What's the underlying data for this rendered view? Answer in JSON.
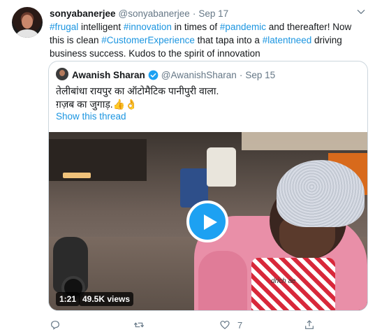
{
  "tweet": {
    "author_name": "sonyabanerjee",
    "author_handle": "@sonyabanerjee",
    "separator": "·",
    "time": "Sep 17",
    "text_segments": [
      {
        "t": "#frugal",
        "tag": true
      },
      {
        "t": " intelligent ",
        "tag": false
      },
      {
        "t": "#innovation",
        "tag": true
      },
      {
        "t": " in times of ",
        "tag": false
      },
      {
        "t": "#pandemic",
        "tag": true
      },
      {
        "t": " and thereafter! Now this is clean ",
        "tag": false
      },
      {
        "t": "#CustomerExperience",
        "tag": true
      },
      {
        "t": " that tapa into a ",
        "tag": false
      },
      {
        "t": "#latentneed",
        "tag": true
      },
      {
        "t": " driving business success. Kudos to the spirit of innovation",
        "tag": false
      }
    ],
    "menu_icon": "chevron-down-icon"
  },
  "quoted": {
    "author_name": "Awanish Sharan",
    "verified_icon": "verified-badge-icon",
    "author_handle": "@AwanishSharan",
    "separator": "·",
    "time": "Sep 15",
    "text_line1": "तेलीबांधा रायपुर का ऑटोमैटिक पानीपुरी वाला.",
    "text_line2": "ग़ज़ब का जुगाड़.👍👌",
    "show_thread": "Show this thread",
    "video": {
      "duration": "1:21",
      "views": "49.5K views",
      "play_icon": "play-icon",
      "apron_text": "drich  ae"
    }
  },
  "actions": {
    "reply_icon": "reply-icon",
    "retweet_icon": "retweet-icon",
    "like_icon": "heart-icon",
    "like_count": "7",
    "share_icon": "share-icon"
  },
  "colors": {
    "link": "#1b95e0",
    "text": "#14171a",
    "muted": "#657786",
    "play_button": "#1da1f2"
  }
}
